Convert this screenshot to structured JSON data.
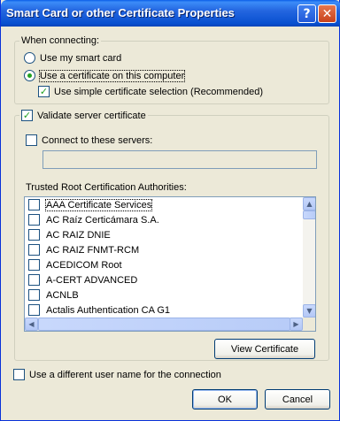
{
  "window": {
    "title": "Smart Card or other Certificate Properties"
  },
  "titlebar_buttons": {
    "help": "?",
    "close": "✕"
  },
  "connecting": {
    "legend": "When connecting:",
    "use_smart_card": "Use my smart card",
    "use_certificate": "Use a certificate on this computer",
    "use_simple_selection": "Use simple certificate selection (Recommended)",
    "selected": "use_certificate",
    "simple_selection_checked": true
  },
  "validate": {
    "label": "Validate server certificate",
    "checked": true,
    "connect_servers_label": "Connect to these servers:",
    "connect_servers_checked": false,
    "servers_value": ""
  },
  "trusted_root": {
    "label": "Trusted Root Certification Authorities:",
    "items": [
      "AAA Certificate Services",
      "AC Raíz Certicámara S.A.",
      "AC RAIZ DNIE",
      "AC RAIZ FNMT-RCM",
      "ACEDICOM Root",
      "A-CERT ADVANCED",
      "ACNLB",
      "Actalis Authentication CA G1"
    ]
  },
  "view_certificate_button": "View Certificate",
  "different_user": {
    "label": "Use a different user name for the connection",
    "checked": false
  },
  "ok_button": "OK",
  "cancel_button": "Cancel",
  "colors": {
    "titlebar": "#0a5fe8",
    "dialog_bg": "#ece9d8",
    "check_mark": "#21a121"
  }
}
